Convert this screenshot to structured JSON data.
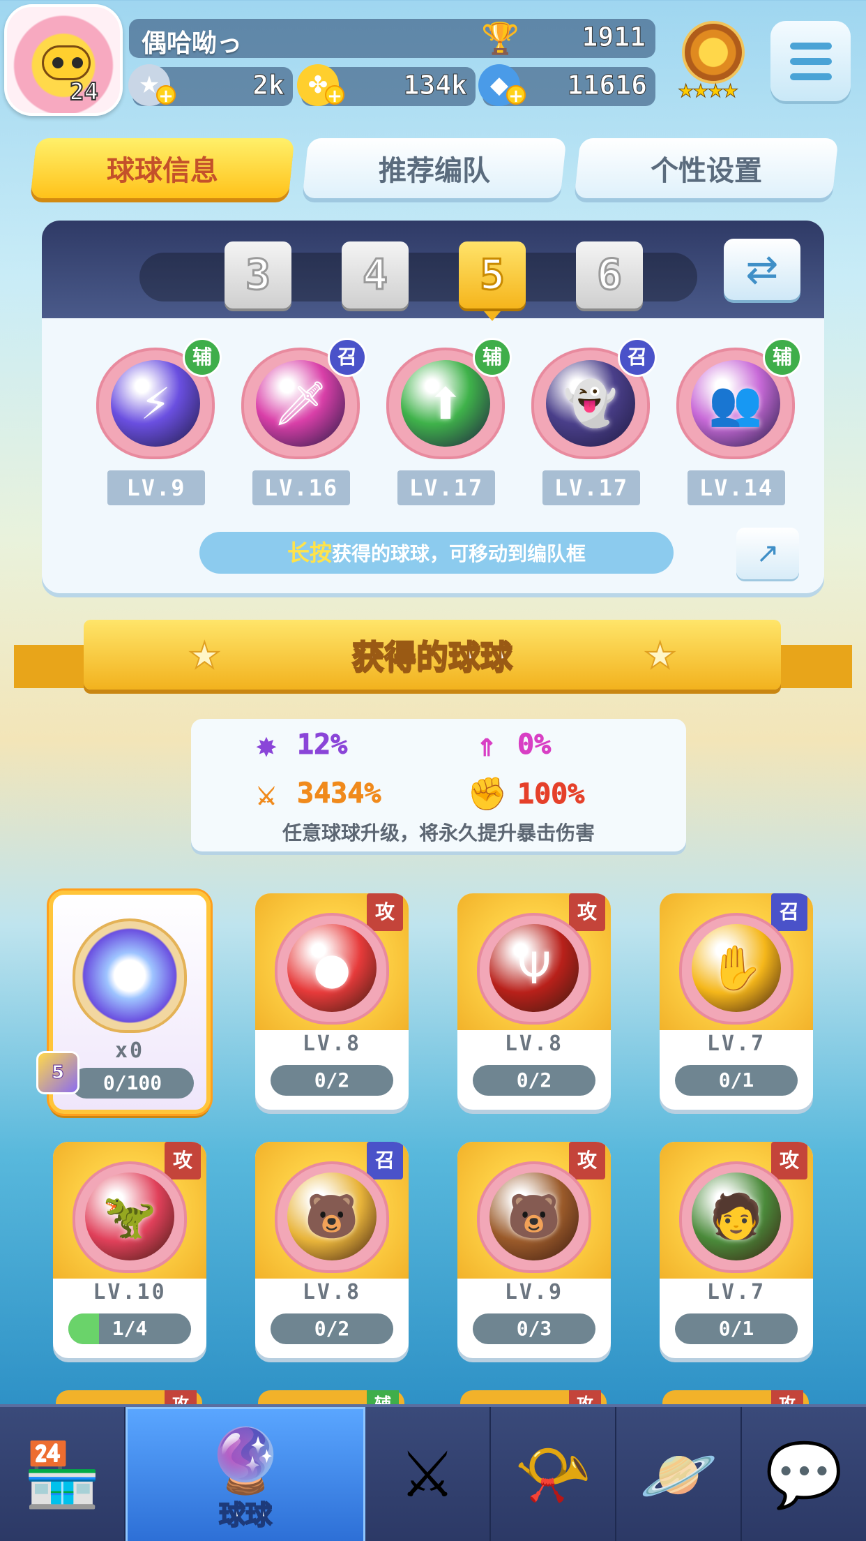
{
  "player": {
    "level": "24",
    "name": "偶哈呦っ",
    "trophies": "1911"
  },
  "resources": [
    {
      "icon": "star-coin-icon",
      "value": "2k"
    },
    {
      "icon": "clover-coin-icon",
      "value": "134k"
    },
    {
      "icon": "diamond-icon",
      "value": "11616"
    }
  ],
  "tabs": [
    "球球信息",
    "推荐编队",
    "个性设置"
  ],
  "team": {
    "slots": [
      "3",
      "4",
      "5",
      "6"
    ],
    "selected_slot": "5",
    "members": [
      {
        "name": "lightning-ball",
        "tag": "辅",
        "level": "LV.9",
        "color": "#6a4fe0"
      },
      {
        "name": "sword-ball",
        "tag": "召",
        "level": "LV.16",
        "color": "#d93fa8"
      },
      {
        "name": "arrow-ball",
        "tag": "辅",
        "level": "LV.17",
        "color": "#3fb24a"
      },
      {
        "name": "ghost-ball",
        "tag": "召",
        "level": "LV.17",
        "color": "#4a3f8a"
      },
      {
        "name": "crowd-ball",
        "tag": "辅",
        "level": "LV.14",
        "color": "#c86ad8"
      }
    ],
    "hint_highlight": "长按",
    "hint_text": "获得的球球，可移动到编队框"
  },
  "section_title": "获得的球球",
  "stats": {
    "items": [
      {
        "icon": "crit-rate-icon",
        "value": "12%",
        "color": "#8a45d8"
      },
      {
        "icon": "boost-icon",
        "value": "0%",
        "color": "#d83fc4"
      },
      {
        "icon": "crit-damage-icon",
        "value": "3434%",
        "color": "#f08a1c"
      },
      {
        "icon": "power-icon",
        "value": "100%",
        "color": "#e5402a"
      }
    ],
    "note": "任意球球升级，将永久提升暴击伤害"
  },
  "balls": [
    {
      "name": "universal-card",
      "tag": "",
      "level": "x0",
      "progress": "0/100",
      "fill": 0,
      "color": "#5a7bf0"
    },
    {
      "name": "red-ball",
      "tag": "攻",
      "level": "LV.8",
      "progress": "0/2",
      "fill": 0,
      "color": "#e63a3a"
    },
    {
      "name": "trident-ball",
      "tag": "攻",
      "level": "LV.8",
      "progress": "0/2",
      "fill": 0,
      "color": "#b8201a"
    },
    {
      "name": "palm-ball",
      "tag": "召",
      "level": "LV.7",
      "progress": "0/1",
      "fill": 0,
      "color": "#f5b71a"
    },
    {
      "name": "dinosaur-ball",
      "tag": "攻",
      "level": "LV.10",
      "progress": "1/4",
      "fill": 0.25,
      "color": "#e0405a"
    },
    {
      "name": "bear-yellow-ball",
      "tag": "召",
      "level": "LV.8",
      "progress": "0/2",
      "fill": 0,
      "color": "#e8b43a"
    },
    {
      "name": "bear-brown-ball",
      "tag": "攻",
      "level": "LV.9",
      "progress": "0/3",
      "fill": 0,
      "color": "#9a5a2a"
    },
    {
      "name": "logger-ball",
      "tag": "攻",
      "level": "LV.7",
      "progress": "0/1",
      "fill": 0,
      "color": "#4a8a3a"
    }
  ],
  "peek_tags": [
    "攻",
    "辅",
    "攻",
    "攻"
  ],
  "puzzle_badge": "5",
  "nav": [
    {
      "icon": "shop-icon",
      "label": ""
    },
    {
      "icon": "ball-icon",
      "label": "球球"
    },
    {
      "icon": "crossed-swords-icon",
      "label": ""
    },
    {
      "icon": "whistle-icon",
      "label": ""
    },
    {
      "icon": "planet-icon",
      "label": ""
    },
    {
      "icon": "chat-icon",
      "label": ""
    }
  ]
}
